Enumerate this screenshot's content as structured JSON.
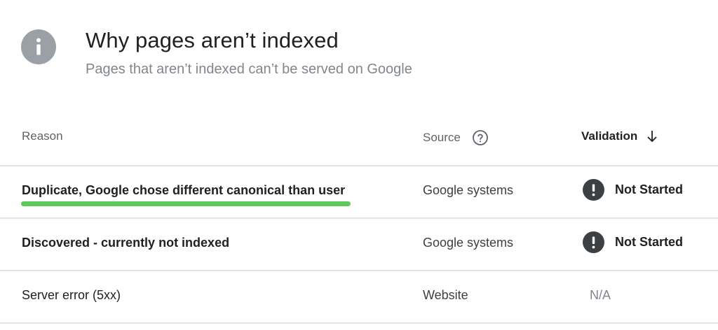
{
  "header": {
    "icon": "info-icon",
    "title": "Why pages aren’t indexed",
    "subtitle": "Pages that aren’t indexed can’t be served on Google"
  },
  "table": {
    "columns": {
      "reason": "Reason",
      "source": "Source",
      "validation": "Validation"
    },
    "rows": [
      {
        "reason": "Duplicate, Google chose different canonical than user",
        "source": "Google systems",
        "validation": "Not Started",
        "highlighted": true
      },
      {
        "reason": "Discovered - currently not indexed",
        "source": "Google systems",
        "validation": "Not Started"
      },
      {
        "reason": "Server error (5xx)",
        "source": "Website",
        "validation": "N/A"
      }
    ]
  },
  "colors": {
    "highlight": "#5ec95b",
    "status_icon": "#3c4043",
    "info_icon": "#9aa0a6"
  }
}
